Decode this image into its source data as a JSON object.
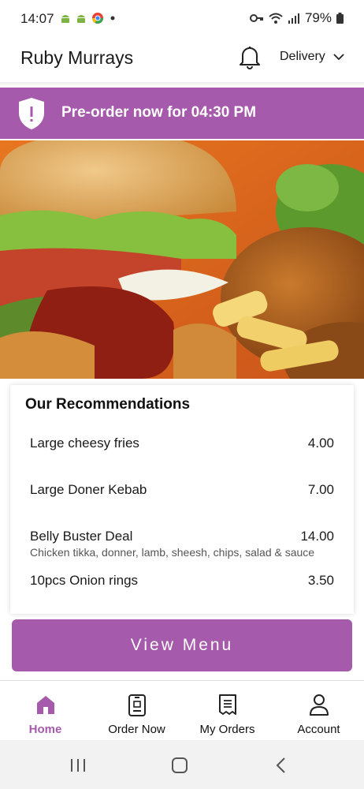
{
  "status_bar": {
    "time": "14:07",
    "battery": "79%",
    "icons": [
      "android-icon",
      "android-icon",
      "chrome-icon",
      "dot-icon",
      "key-icon",
      "wifi-icon",
      "signal-icon",
      "battery-icon"
    ]
  },
  "header": {
    "title": "Ruby Murrays",
    "mode_label": "Delivery",
    "icons": [
      "bell-icon",
      "chevron-down-icon"
    ]
  },
  "banner": {
    "text": "Pre-order now for 04:30 PM",
    "icon": "shield-alert-icon"
  },
  "hero": {
    "image": "burger-fries-food-photo"
  },
  "recommendations": {
    "title": "Our Recommendations",
    "items": [
      {
        "name": "Large cheesy fries",
        "price": "4.00",
        "description": ""
      },
      {
        "name": "Large Doner Kebab",
        "price": "7.00",
        "description": ""
      },
      {
        "name": "Belly Buster Deal",
        "price": "14.00",
        "description": "Chicken tikka, donner, lamb, sheesh, chips, salad & sauce"
      },
      {
        "name": "10pcs Onion rings",
        "price": "3.50",
        "description": ""
      }
    ]
  },
  "view_menu_label": "View Menu",
  "tabs": [
    {
      "label": "Home",
      "icon": "home-icon",
      "active": true
    },
    {
      "label": "Order Now",
      "icon": "order-icon",
      "active": false
    },
    {
      "label": "My Orders",
      "icon": "receipt-icon",
      "active": false
    },
    {
      "label": "Account",
      "icon": "user-icon",
      "active": false
    }
  ],
  "colors": {
    "accent": "#a65aab"
  }
}
